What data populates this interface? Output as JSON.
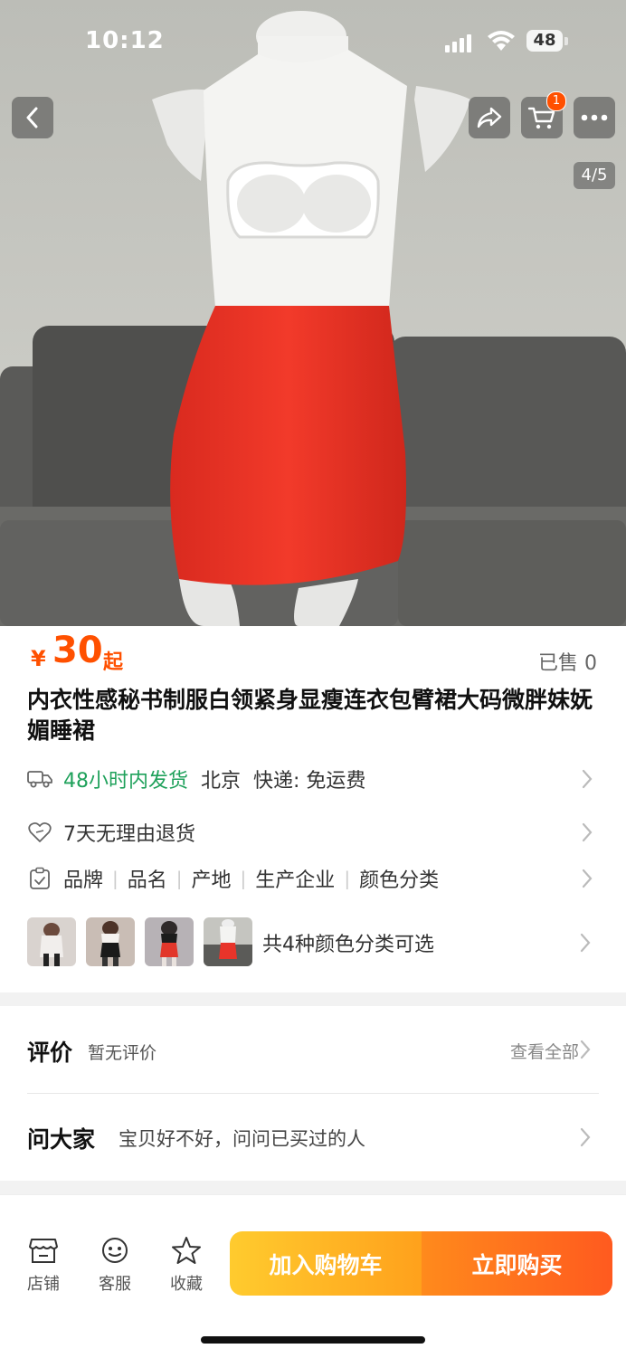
{
  "status_bar": {
    "time": "10:12",
    "battery": "48"
  },
  "nav": {
    "back_icon": "chevron-left-icon",
    "share_icon": "share-icon",
    "cart_icon": "cart-icon",
    "cart_badge": "1",
    "more_icon": "more-icon",
    "image_counter": "4/5"
  },
  "product": {
    "price_symbol": "¥",
    "price": "30",
    "price_suffix": "起",
    "sold": "已售 0",
    "title": "内衣性感秘书制服白领紧身显瘦连衣包臂裙大码微胖妹妩媚睡裙"
  },
  "shipping": {
    "dispatch": "48小时内发货",
    "location": "北京",
    "express": "快递: 免运费"
  },
  "returns": {
    "text": "7天无理由退货"
  },
  "params": {
    "items": [
      "品牌",
      "品名",
      "产地",
      "生产企业",
      "颜色分类"
    ]
  },
  "variants": {
    "text": "共4种颜色分类可选",
    "count": 4
  },
  "reviews": {
    "title": "评价",
    "subtitle": "暂无评价",
    "view_all": "查看全部"
  },
  "ask": {
    "title": "问大家",
    "subtitle": "宝贝好不好，问问已买过的人"
  },
  "bottom_bar": {
    "shop": "店铺",
    "service": "客服",
    "favorite": "收藏",
    "add_to_cart": "加入购物车",
    "buy_now": "立即购买"
  },
  "colors": {
    "accent": "#ff5000",
    "green": "#1fa15b",
    "cart_button": "#ffb324",
    "buy_button": "#ff6a1f"
  }
}
